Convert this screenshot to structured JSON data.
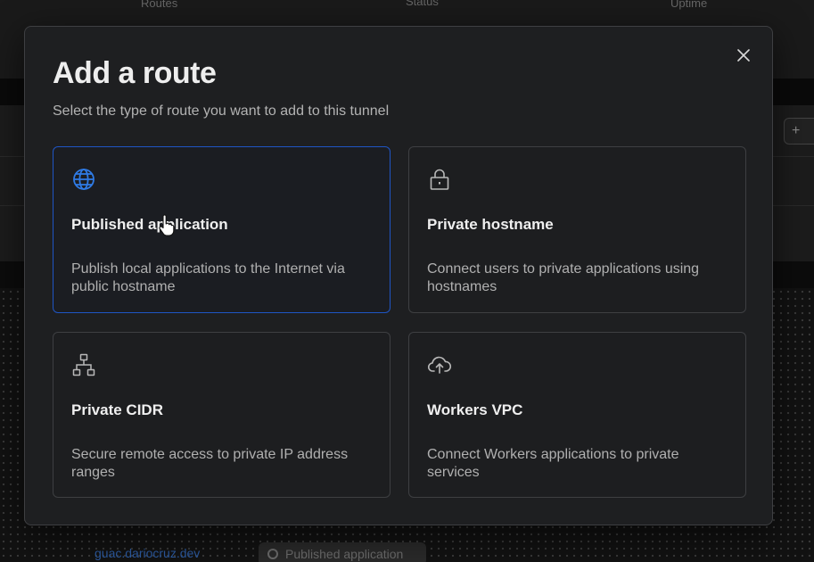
{
  "modal": {
    "title": "Add a route",
    "subtitle": "Select the type of route you want to add to this tunnel",
    "close_icon": "close-icon"
  },
  "cards": [
    {
      "title": "Published application",
      "description": "Publish local applications to the Internet via public hostname",
      "icon": "globe-icon",
      "selected": true
    },
    {
      "title": "Private hostname",
      "description": "Connect users to private applications using hostnames",
      "icon": "lock-icon",
      "selected": false
    },
    {
      "title": "Private CIDR",
      "description": "Secure remote access to private IP address ranges",
      "icon": "network-icon",
      "selected": false
    },
    {
      "title": "Workers VPC",
      "description": "Connect Workers applications to private services",
      "icon": "cloud-upload-icon",
      "selected": false
    }
  ],
  "background": {
    "header_routes": "Routes",
    "header_status": "Status",
    "header_uptime": "Uptime",
    "route_link": "guac.dariocruz.dev",
    "route_type": "Published application"
  },
  "colors": {
    "accent_blue": "#1f55c4",
    "globe_blue": "#2f7be6",
    "modal_bg": "#1e1f21"
  }
}
